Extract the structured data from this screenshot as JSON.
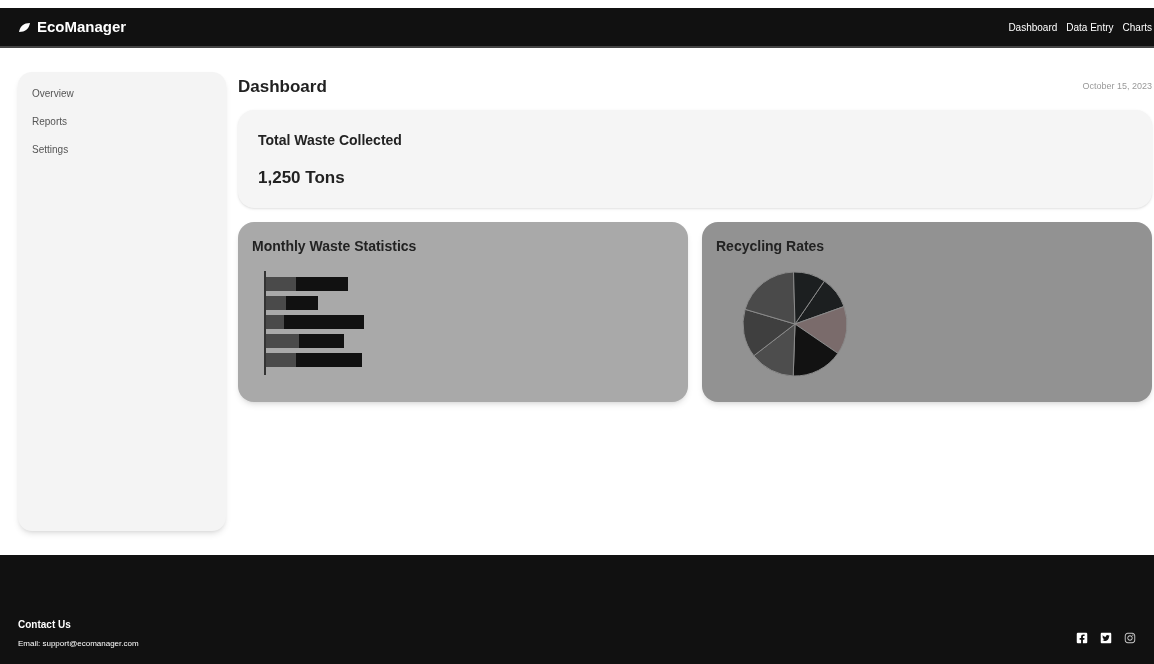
{
  "header": {
    "logo": "EcoManager",
    "nav": [
      "Dashboard",
      "Data Entry",
      "Charts"
    ]
  },
  "sidebar": {
    "items": [
      "Overview",
      "Reports",
      "Settings"
    ]
  },
  "main": {
    "title": "Dashboard",
    "date": "October 15, 2023",
    "summary": {
      "label": "Total Waste Collected",
      "value": "1,250 Tons"
    },
    "cards": [
      {
        "title": "Monthly Waste Statistics",
        "kind": "bar"
      },
      {
        "title": "Recycling Rates",
        "kind": "pie"
      }
    ]
  },
  "footer": {
    "heading": "Contact Us",
    "email": "Email: support@ecomanager.com"
  }
}
